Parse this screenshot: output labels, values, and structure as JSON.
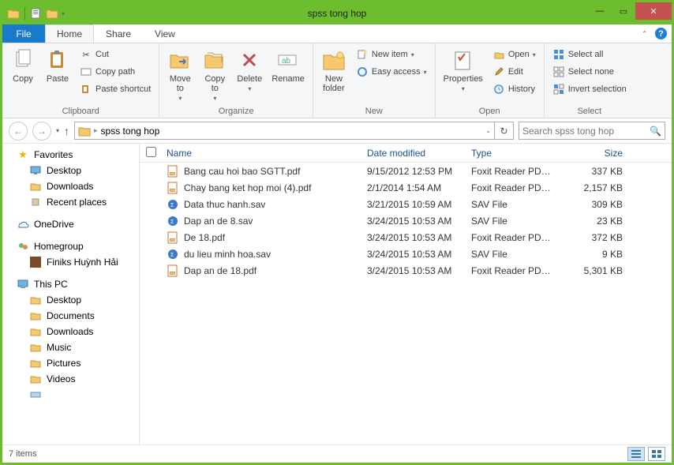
{
  "window": {
    "title": "spss tong hop"
  },
  "tabs": {
    "file": "File",
    "home": "Home",
    "share": "Share",
    "view": "View"
  },
  "ribbon": {
    "clipboard": {
      "label": "Clipboard",
      "copy": "Copy",
      "paste": "Paste",
      "cut": "Cut",
      "copy_path": "Copy path",
      "paste_shortcut": "Paste shortcut"
    },
    "organize": {
      "label": "Organize",
      "move_to": "Move\nto",
      "copy_to": "Copy\nto",
      "delete": "Delete",
      "rename": "Rename"
    },
    "new": {
      "label": "New",
      "new_folder": "New\nfolder",
      "new_item": "New item",
      "easy_access": "Easy access"
    },
    "open": {
      "label": "Open",
      "properties": "Properties",
      "open": "Open",
      "edit": "Edit",
      "history": "History"
    },
    "select": {
      "label": "Select",
      "select_all": "Select all",
      "select_none": "Select none",
      "invert": "Invert selection"
    }
  },
  "addr": {
    "location": "spss tong hop"
  },
  "search": {
    "placeholder": "Search spss tong hop"
  },
  "nav": {
    "favorites": {
      "label": "Favorites",
      "items": [
        "Desktop",
        "Downloads",
        "Recent places"
      ]
    },
    "onedrive": "OneDrive",
    "homegroup": {
      "label": "Homegroup",
      "items": [
        "Finiks Huỳnh Hải"
      ]
    },
    "thispc": {
      "label": "This PC",
      "items": [
        "Desktop",
        "Documents",
        "Downloads",
        "Music",
        "Pictures",
        "Videos"
      ]
    }
  },
  "columns": {
    "name": "Name",
    "date": "Date modified",
    "type": "Type",
    "size": "Size"
  },
  "files": [
    {
      "name": "Bang cau hoi bao SGTT.pdf",
      "date": "9/15/2012 12:53 PM",
      "type": "Foxit Reader PDF ...",
      "size": "337 KB",
      "kind": "pdf"
    },
    {
      "name": "Chay bang ket hop moi (4).pdf",
      "date": "2/1/2014 1:54 AM",
      "type": "Foxit Reader PDF ...",
      "size": "2,157 KB",
      "kind": "pdf"
    },
    {
      "name": "Data thuc hanh.sav",
      "date": "3/21/2015 10:59 AM",
      "type": "SAV File",
      "size": "309 KB",
      "kind": "sav"
    },
    {
      "name": "Dap an de 8.sav",
      "date": "3/24/2015 10:53 AM",
      "type": "SAV File",
      "size": "23 KB",
      "kind": "sav"
    },
    {
      "name": "De 18.pdf",
      "date": "3/24/2015 10:53 AM",
      "type": "Foxit Reader PDF ...",
      "size": "372 KB",
      "kind": "pdf"
    },
    {
      "name": "du lieu minh hoa.sav",
      "date": "3/24/2015 10:53 AM",
      "type": "SAV File",
      "size": "9 KB",
      "kind": "sav"
    },
    {
      "name": "Dap an de 18.pdf",
      "date": "3/24/2015 10:53 AM",
      "type": "Foxit Reader PDF ...",
      "size": "5,301 KB",
      "kind": "pdf"
    }
  ],
  "status": {
    "count": "7 items"
  }
}
